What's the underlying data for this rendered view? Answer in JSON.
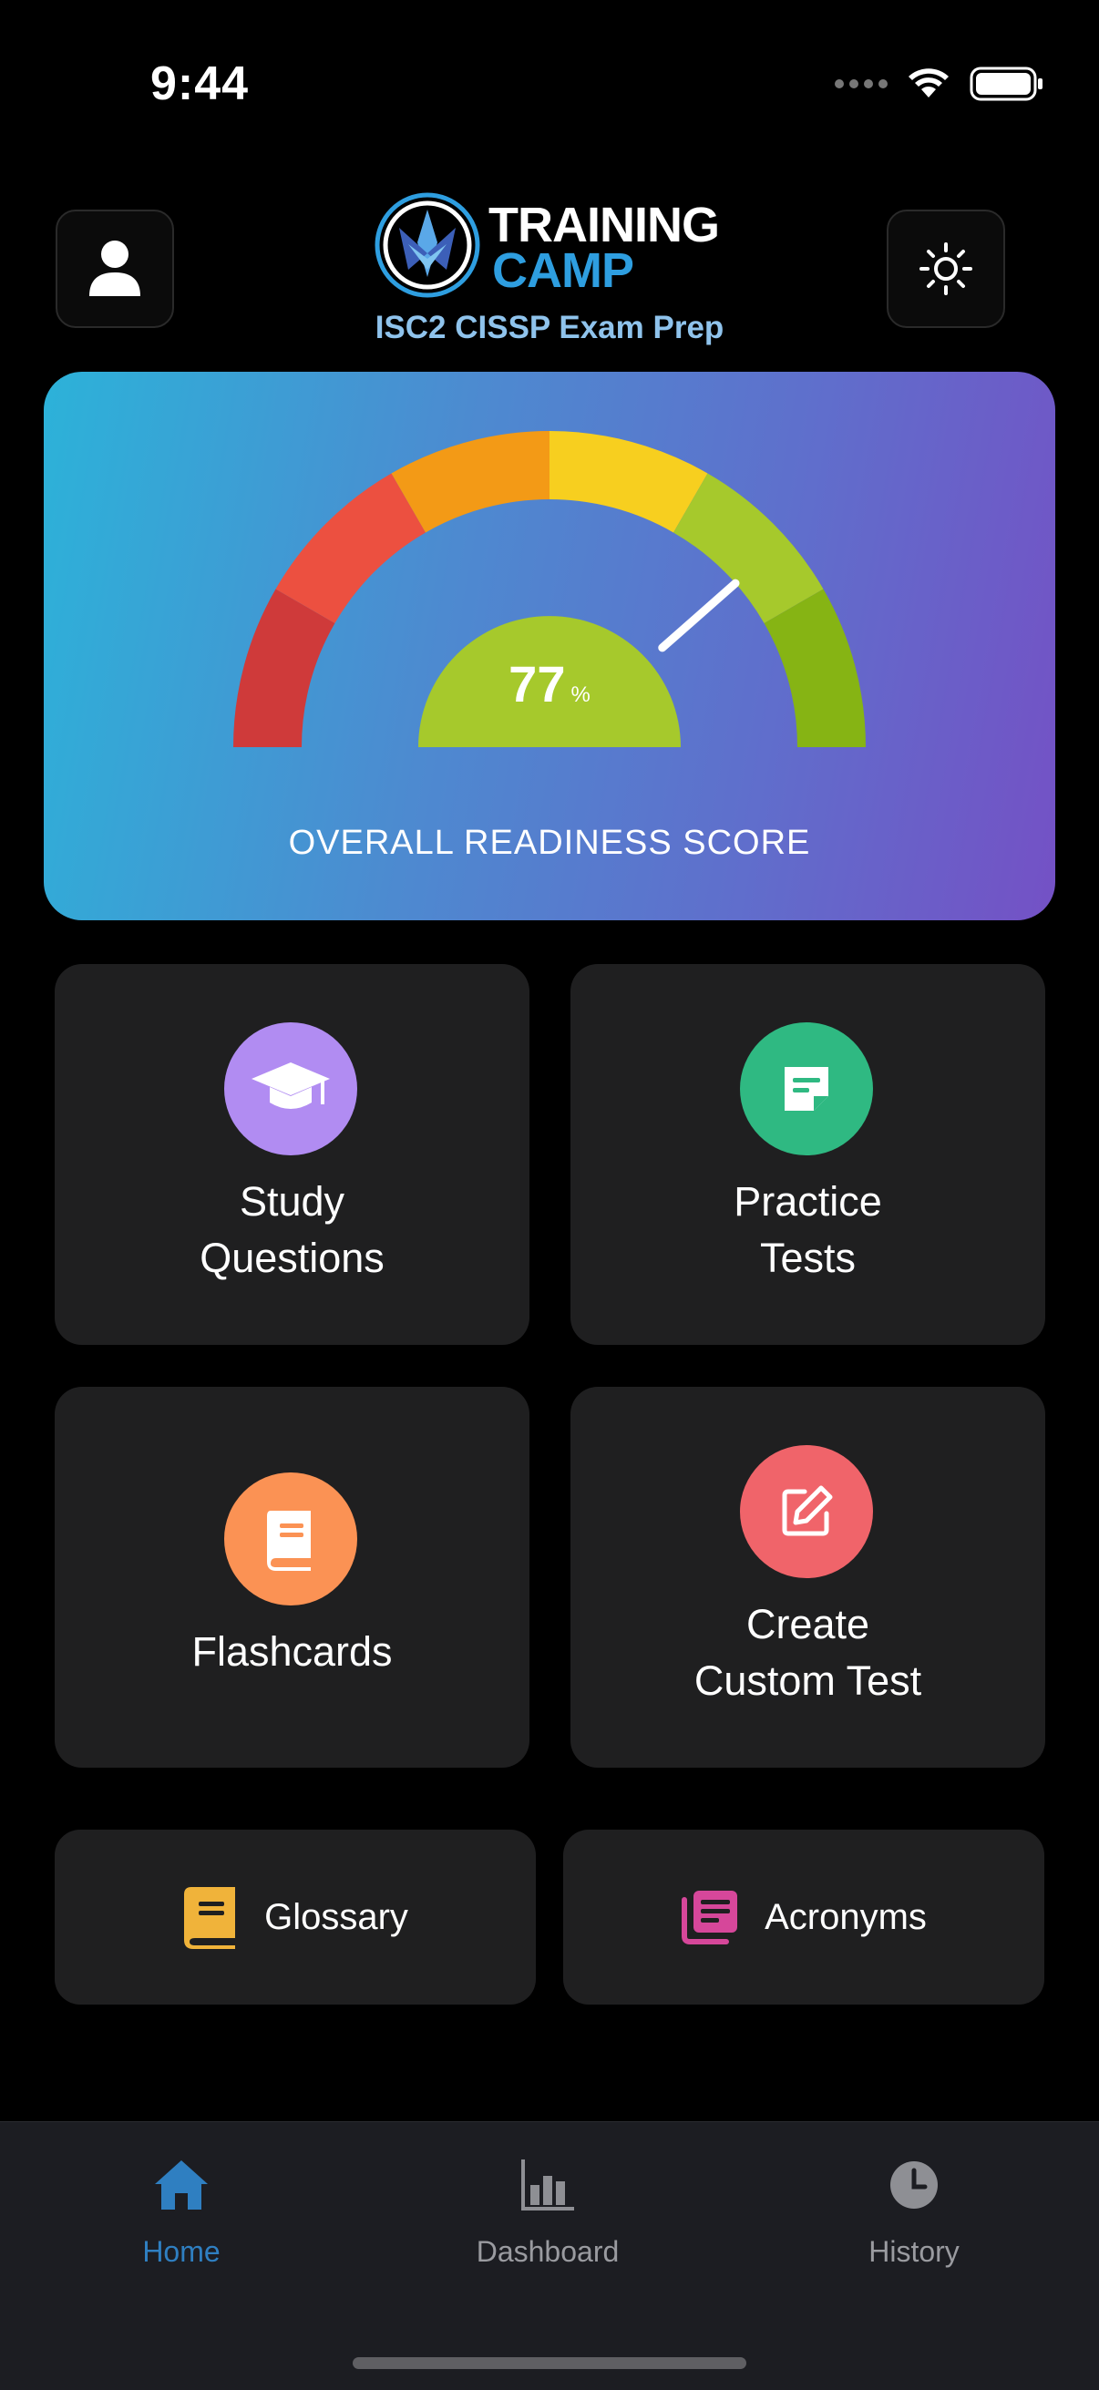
{
  "status_bar": {
    "time": "9:44"
  },
  "header": {
    "logo_line1": "TRAINING",
    "logo_line2": "CAMP",
    "subtitle": "ISC2 CISSP Exam Prep",
    "profile_icon": "person-icon",
    "theme_icon": "sun-icon"
  },
  "readiness": {
    "value": 77,
    "unit": "%",
    "label": "OVERALL READINESS SCORE"
  },
  "tiles": {
    "study": {
      "line1": "Study",
      "line2": "Questions",
      "icon": "graduation-cap-icon",
      "color": "#b18cf2"
    },
    "practice": {
      "line1": "Practice",
      "line2": "Tests",
      "icon": "note-icon",
      "color": "#2fb982"
    },
    "flashcards": {
      "label": "Flashcards",
      "icon": "book-icon",
      "color": "#fb9254"
    },
    "custom": {
      "line1": "Create",
      "line2": "Custom Test",
      "icon": "edit-icon",
      "color": "#f0646a"
    }
  },
  "quick_links": {
    "glossary": {
      "label": "Glossary",
      "icon": "glossary-book-icon",
      "color": "#f0b33a"
    },
    "acronyms": {
      "label": "Acronyms",
      "icon": "acronyms-icon",
      "color": "#d6479a"
    }
  },
  "tabbar": {
    "home": "Home",
    "dashboard": "Dashboard",
    "history": "History",
    "active": "Home",
    "active_color": "#2f7fc1"
  }
}
